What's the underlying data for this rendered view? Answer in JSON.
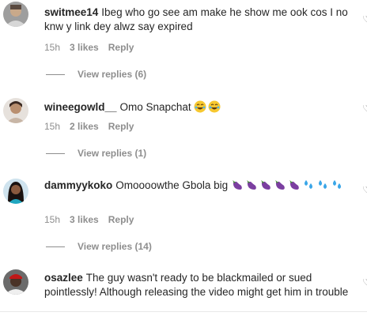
{
  "comments": [
    {
      "username": "switmee14",
      "text": "Ibeg who go see am make he show me ook cos I no knw y link dey alwz say expired",
      "time": "15h",
      "likes": "3 likes",
      "reply_label": "Reply",
      "view_replies": "View replies (6)",
      "avatar_icon": "avatar-photo"
    },
    {
      "username": "wineegowld__",
      "text": "Omo Snapchat",
      "emojis": [
        "😂",
        "😂"
      ],
      "time": "15h",
      "likes": "2 likes",
      "reply_label": "Reply",
      "view_replies": "View replies (1)",
      "avatar_icon": "avatar-photo"
    },
    {
      "username": "dammyykoko",
      "text": "Omoooowthe Gbola big",
      "emojis": [
        "🍆",
        "🍆",
        "🍆",
        "🍆",
        "🍆",
        "💦",
        "💦",
        "💦"
      ],
      "time": "15h",
      "likes": "3 likes",
      "reply_label": "Reply",
      "view_replies": "View replies (14)",
      "avatar_icon": "avatar-photo"
    },
    {
      "username": "osazlee",
      "text": "The guy wasn't ready to be blackmailed or sued pointlessly! Although releasing the video might get him in trouble",
      "avatar_icon": "avatar-photo"
    }
  ],
  "colors": {
    "text": "#262626",
    "muted": "#8e8e8e",
    "eggplant": "#7b3fa0",
    "sweat": "#3aa6e8"
  }
}
